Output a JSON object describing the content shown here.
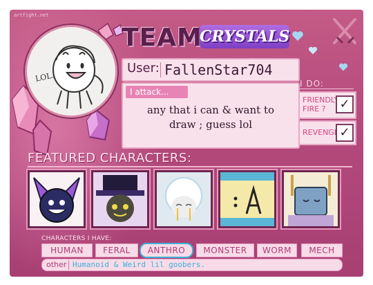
{
  "credit": "artfight.net",
  "title": {
    "team": "TEAM",
    "crystals": "CRYSTALS"
  },
  "avatar": {
    "caption": "LOL."
  },
  "user": {
    "label": "User:",
    "name": "FallenStar704"
  },
  "attack": {
    "label": "I attack...",
    "line1": "any that i can & want to",
    "line2": "draw ; guess lol"
  },
  "i_do": {
    "label": "I DO:",
    "friendly_fire_line1": "FRIENDLY",
    "friendly_fire_line2": "FIRE ?",
    "friendly_fire_check": "✓",
    "revenge": "REVENGE",
    "revenge_check": "✓"
  },
  "featured": {
    "title": "FEATURED CHARACTERS:"
  },
  "characters_have": {
    "label": "CHARACTERS I HAVE:",
    "tags": [
      "HUMAN",
      "FERAL",
      "ANTHRO",
      "MONSTER",
      "WORM",
      "MECH"
    ],
    "selected": "ANTHRO",
    "other_label": "other",
    "other_value": "Humanoid & Weird lil goobers."
  },
  "colors": {
    "card": "#b44a7c",
    "panel": "#f9e1ec",
    "accent_purple": "#7e3fc4",
    "tag_text": "#b23a73",
    "highlight_blue": "#3fb0d6"
  },
  "icons": [
    "crossed-swords-icon",
    "heart-icon",
    "crystal-icon"
  ]
}
